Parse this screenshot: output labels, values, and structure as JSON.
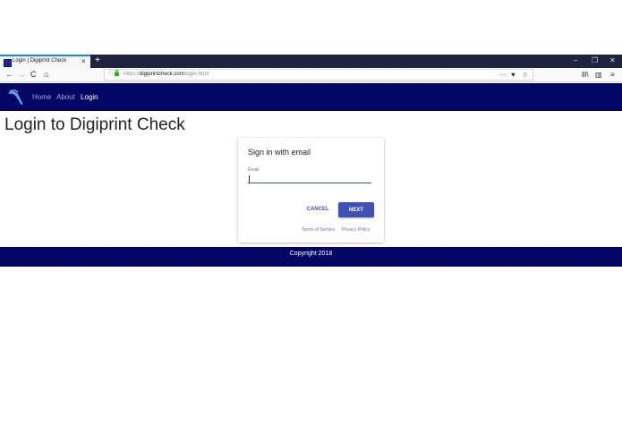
{
  "browser": {
    "tab_title": "Login | Digiprint Check",
    "tab_close": "×",
    "new_tab": "+",
    "window_controls": {
      "minimize": "–",
      "restore": "❐",
      "close": "✕"
    },
    "nav": {
      "back": "←",
      "forward": "→",
      "reload": "C",
      "home": "⌂"
    },
    "url_scheme": "https://",
    "url_host": "digiprintcheck.com",
    "url_path": "/login.html",
    "url_actions": {
      "more": "···",
      "pocket": "♥",
      "bookmark": "☆"
    },
    "tools": {
      "library": "lll\\",
      "sidebar": "▥",
      "menu": "≡"
    }
  },
  "site": {
    "nav": {
      "home": "Home",
      "about": "About",
      "login": "Login"
    }
  },
  "page": {
    "title": "Login to Digiprint Check"
  },
  "signin": {
    "heading": "Sign in with email",
    "email_label": "Email",
    "email_value": "",
    "cancel": "CANCEL",
    "next": "NEXT",
    "terms": "Terms of Service",
    "privacy": "Privacy Policy"
  },
  "footer": {
    "copyright": "Copyright 2018"
  },
  "colors": {
    "header_bg": "#020564",
    "accent": "#3f51b5",
    "tabbar_bg": "#202340"
  }
}
